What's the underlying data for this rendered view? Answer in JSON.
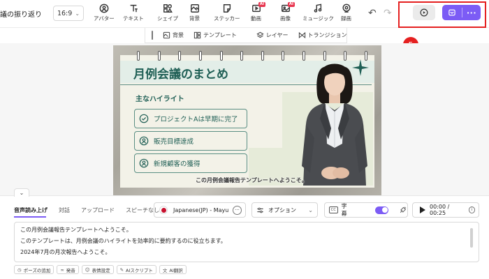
{
  "header": {
    "doc_title": "議の振り返り",
    "aspect_ratio": "16:9",
    "tools": [
      {
        "label": "アバター",
        "icon": "avatar-icon"
      },
      {
        "label": "テキスト",
        "icon": "text-icon"
      },
      {
        "label": "シェイプ",
        "icon": "shape-icon"
      },
      {
        "label": "背景",
        "icon": "background-icon"
      },
      {
        "label": "ステッカー",
        "icon": "sticker-icon"
      },
      {
        "label": "動画",
        "icon": "video-icon",
        "badge": "AI"
      },
      {
        "label": "画像",
        "icon": "image-icon",
        "badge": "AI"
      },
      {
        "label": "ミュージック",
        "icon": "music-icon"
      },
      {
        "label": "録画",
        "icon": "record-icon"
      }
    ],
    "step_number": "5",
    "colors": {
      "accent": "#7c5cf5",
      "highlight": "#e52020"
    }
  },
  "canvas_toolbar": {
    "background": "背景",
    "template": "テンプレート",
    "layer": "レイヤー",
    "transition": "トランジション"
  },
  "slide": {
    "title": "月例会議のまとめ",
    "subheading": "主なハイライト",
    "items": [
      {
        "text": "プロジェクトAは早期に完了",
        "icon": "check-circle-icon"
      },
      {
        "text": "販売目標達成",
        "icon": "person-circle-icon"
      },
      {
        "text": "新規顧客の獲得",
        "icon": "person-circle-icon"
      }
    ],
    "caption": "この月例会議報告テンプレートへようこそ。",
    "colors": {
      "primary": "#1f5f55",
      "paper": "#f3f2e8"
    }
  },
  "panel": {
    "tabs": [
      "音声読み上げ",
      "対話",
      "アップロード",
      "スピーチなし"
    ],
    "voice": "Japanese(JP) - Mayu",
    "options": "オプション",
    "subtitles": "字幕",
    "time": "00:00 / 00:25",
    "script_lines": [
      "この月例会議報告テンプレートへようこそ。",
      "このテンプレートは、月例会議のハイライトを効率的に要約するのに役立ちます。",
      "2024年7月の月次報告へようこそ。"
    ],
    "chips": [
      {
        "label": "ポーズの追加",
        "icon": "pause-icon"
      },
      {
        "label": "発音",
        "icon": "pronunciation-icon"
      },
      {
        "label": "表情設定",
        "icon": "expression-icon"
      },
      {
        "label": "AIスクリプト",
        "icon": "ai-script-icon"
      },
      {
        "label": "AI翻訳",
        "icon": "ai-translate-icon"
      }
    ]
  }
}
